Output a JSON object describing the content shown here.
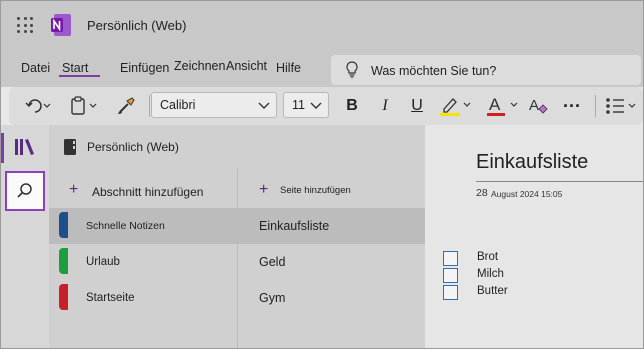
{
  "app": {
    "title": "Persönlich (Web)"
  },
  "menu": {
    "items": [
      "Datei",
      "Start",
      "Einfügen",
      "Zeichnen",
      "Ansicht",
      "Hilfe"
    ],
    "active": "Start",
    "tell_me": "Was möchten Sie tun?"
  },
  "toolbar": {
    "font": "Calibri",
    "size": "11",
    "bold": "B",
    "italic": "I",
    "underline": "U",
    "font_color_glyph": "A",
    "more": "···",
    "highlight_color": "#f2e600",
    "font_color": "#d02020"
  },
  "notebook": {
    "title": "Persönlich (Web)"
  },
  "sections": {
    "add_label": "Abschnitt hinzufügen",
    "items": [
      {
        "label": "Schnelle Notizen",
        "color": "#1f4e8c"
      },
      {
        "label": "Urlaub",
        "color": "#1e9e3e"
      },
      {
        "label": "Startseite",
        "color": "#c8202a"
      }
    ]
  },
  "pages": {
    "add_label": "Seite hinzufügen",
    "items": [
      "Einkaufsliste",
      "Geld",
      "Gym"
    ]
  },
  "page": {
    "title": "Einkaufsliste",
    "date_day": "28",
    "date_rest": "August 2024 15:05",
    "todos": [
      "Brot",
      "Milch",
      "Butter"
    ]
  },
  "colors": {
    "accent": "#7b3fa6"
  }
}
